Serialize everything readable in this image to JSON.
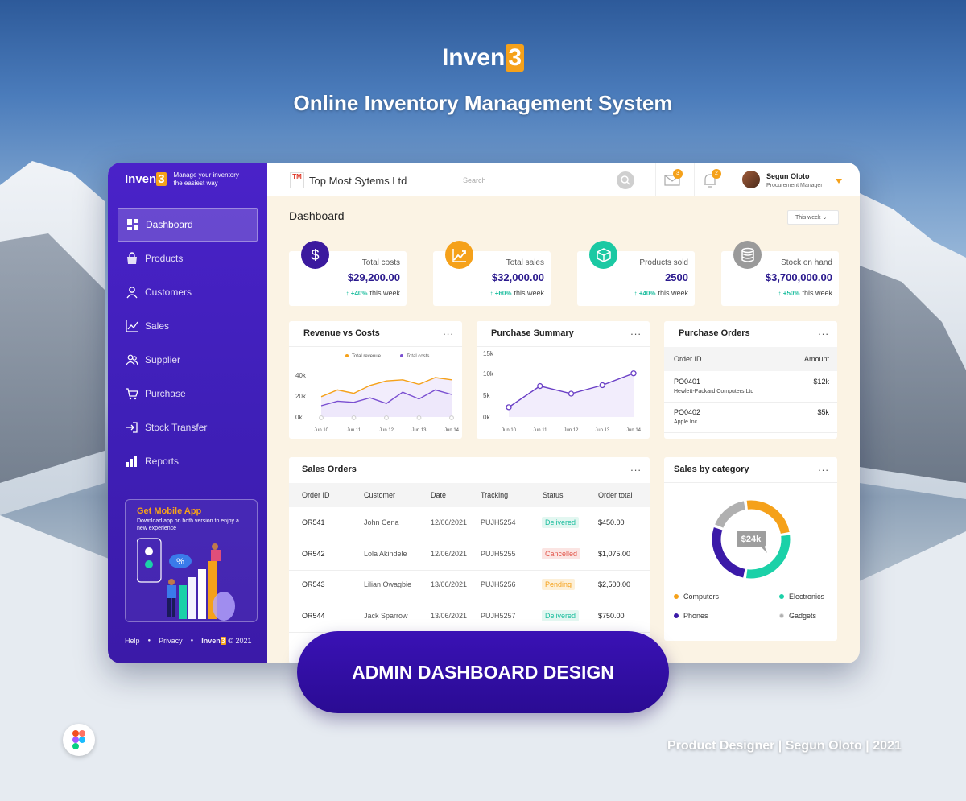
{
  "brand": {
    "name": "Inven",
    "suffix": "3",
    "tagline": "Online Inventory Management System"
  },
  "sidebar": {
    "logo_name": "Inven",
    "logo_suffix": "3",
    "tagline_line1": "Manage your inventory",
    "tagline_line2": "the easiest way",
    "items": [
      {
        "label": "Dashboard",
        "icon": "dashboard-icon",
        "active": true
      },
      {
        "label": "Products",
        "icon": "bag-icon"
      },
      {
        "label": "Customers",
        "icon": "user-icon"
      },
      {
        "label": "Sales",
        "icon": "chart-line-icon"
      },
      {
        "label": "Supplier",
        "icon": "users-icon"
      },
      {
        "label": "Purchase",
        "icon": "cart-icon"
      },
      {
        "label": "Stock Transfer",
        "icon": "transfer-icon"
      },
      {
        "label": "Reports",
        "icon": "bar-chart-icon"
      }
    ],
    "promo": {
      "title": "Get Mobile App",
      "text": "Download app on both version to enjoy a new experience",
      "percent": "%"
    },
    "footer": {
      "help": "Help",
      "privacy": "Privacy",
      "brand": "Inven",
      "brand_suffix": "3",
      "copyright": "© 2021"
    }
  },
  "topbar": {
    "company_logo": "TM",
    "company_name": "Top Most Sytems Ltd",
    "search_placeholder": "Search",
    "mail_badge": "3",
    "bell_badge": "2",
    "user_name": "Segun Oloto",
    "user_role": "Procurement Manager"
  },
  "main": {
    "title": "Dashboard",
    "period": "This week",
    "stats": [
      {
        "label": "Total costs",
        "value": "$29,200.00",
        "change": "+40%",
        "suffix": "this week",
        "icon": "dollar-icon",
        "color": "#3b1a9e"
      },
      {
        "label": "Total sales",
        "value": "$32,000.00",
        "change": "+60%",
        "suffix": "this week",
        "icon": "trend-up-icon",
        "color": "#f5a11a"
      },
      {
        "label": "Products sold",
        "value": "2500",
        "change": "+40%",
        "suffix": "this week",
        "icon": "box-icon",
        "color": "#1bc9a3"
      },
      {
        "label": "Stock on hand",
        "value": "$3,700,000.00",
        "change": "+50%",
        "suffix": "this week",
        "icon": "database-icon",
        "color": "#9a9a9a"
      }
    ]
  },
  "revenue_card": {
    "title": "Revenue vs Costs",
    "menu": "..."
  },
  "purchase_card": {
    "title": "Purchase Summary",
    "menu": "..."
  },
  "purchase_orders": {
    "title": "Purchase Orders",
    "menu": "...",
    "col_id": "Order ID",
    "col_amount": "Amount",
    "rows": [
      {
        "id": "PO0401",
        "vendor": "Hewlett-Packard Computers Ltd",
        "amount": "$12k"
      },
      {
        "id": "PO0402",
        "vendor": "Apple Inc.",
        "amount": "$5k"
      }
    ]
  },
  "sales_orders": {
    "title": "Sales Orders",
    "menu": "...",
    "columns": [
      "Order ID",
      "Customer",
      "Date",
      "Tracking",
      "Status",
      "Order total"
    ],
    "rows": [
      {
        "id": "OR541",
        "customer": "John Cena",
        "date": "12/06/2021",
        "tracking": "PUJH5254",
        "status": "Delivered",
        "total": "$450.00"
      },
      {
        "id": "OR542",
        "customer": "Lola Akindele",
        "date": "12/06/2021",
        "tracking": "PUJH5255",
        "status": "Cancelled",
        "total": "$1,075.00"
      },
      {
        "id": "OR543",
        "customer": "Lilian Owagbie",
        "date": "13/06/2021",
        "tracking": "PUJH5256",
        "status": "Pending",
        "total": "$2,500.00"
      },
      {
        "id": "OR544",
        "customer": "Jack Sparrow",
        "date": "13/06/2021",
        "tracking": "PUJH5257",
        "status": "Delivered",
        "total": "$750.00"
      }
    ],
    "status_colors": {
      "Delivered": "#1bbd9e",
      "Cancelled": "#e2574c",
      "Pending": "#f5a11a"
    }
  },
  "category_card": {
    "title": "Sales by category",
    "menu": "...",
    "center": "$24k"
  },
  "banner": "ADMIN DASHBOARD DESIGN",
  "credit": "Product Designer | Segun Oloto | 2021",
  "chart_data": [
    {
      "type": "line",
      "title": "Revenue vs Costs",
      "categories": [
        "Jun 10",
        "Jun 11",
        "Jun 12",
        "Jun 13",
        "Jun 14"
      ],
      "yticks": [
        "0k",
        "20k",
        "40k"
      ],
      "ylim": [
        0,
        50000
      ],
      "series": [
        {
          "name": "Total revenue",
          "color": "#f5a11a",
          "values": [
            18000,
            24000,
            21000,
            28000,
            32000,
            33000,
            29000,
            35000,
            33000
          ]
        },
        {
          "name": "Total costs",
          "color": "#7a4fd1",
          "values": [
            10000,
            14000,
            13000,
            17000,
            12000,
            22000,
            16000,
            24000,
            20000
          ]
        }
      ],
      "x_points": 9,
      "legend": "top"
    },
    {
      "type": "line",
      "title": "Purchase Summary",
      "categories": [
        "Jun 10",
        "Jun 11",
        "Jun 12",
        "Jun 13",
        "Jun 14"
      ],
      "yticks": [
        "0k",
        "5k",
        "10k",
        "15k"
      ],
      "ylim": [
        0,
        15000
      ],
      "series": [
        {
          "color": "#6a3fc6",
          "values": [
            2300,
            7300,
            5500,
            7500,
            10300
          ]
        }
      ]
    },
    {
      "type": "pie",
      "title": "Sales by category",
      "center_label": "$24k",
      "slices": [
        {
          "label": "Computers",
          "value": 25,
          "color": "#f5a11a"
        },
        {
          "label": "Electronics",
          "value": 30,
          "color": "#1bd1a8"
        },
        {
          "label": "Phones",
          "value": 28,
          "color": "#3b1aa8"
        },
        {
          "label": "Gadgets",
          "value": 17,
          "color": "#b0b0b0"
        }
      ]
    }
  ]
}
